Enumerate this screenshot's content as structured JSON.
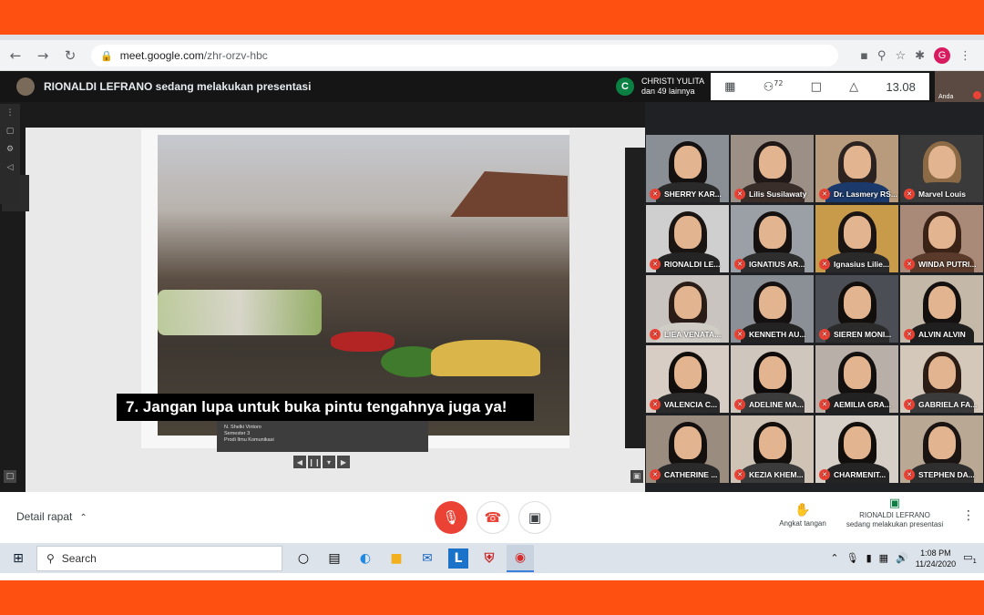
{
  "browser": {
    "url_host": "meet.google.com",
    "url_path": "/zhr-orzv-hbc",
    "profile_initial": "G"
  },
  "meet": {
    "presenting_banner": "RIONALDI LEFRANO sedang melakukan presentasi",
    "chat_chip": {
      "initial": "C",
      "name": "CHRISTI YULITA",
      "more": "dan 49 lainnya"
    },
    "participant_count": "72",
    "time": "13.08",
    "self_label": "Anda",
    "slide": {
      "caption": "7. Jangan lupa untuk buka pintu tengahnya juga ya!",
      "nameplate_line1": "N. Shelki Vintoro",
      "nameplate_line2": "Semester 3",
      "nameplate_line3": "Prodi Ilmu Komunikasi"
    },
    "participants": [
      {
        "name": "SHERRY KAR...",
        "bg": "#8a8f96",
        "hair": "#151110",
        "body": "#2a2a2a"
      },
      {
        "name": "Lilis Susilawaty",
        "bg": "#9c8f86",
        "hair": "#1f1816",
        "body": "#3a2e2a"
      },
      {
        "name": "Dr. Lasmery RS...",
        "bg": "#b79b7c",
        "hair": "#2c2220",
        "body": "#1b3a6b"
      },
      {
        "name": "Marvel Louis",
        "bg": "#3a3a3a",
        "hair": "#8c6a45",
        "body": "#3a3a3a"
      },
      {
        "name": "RIONALDI LE...",
        "bg": "#cfcfcf",
        "hair": "#1a1412",
        "body": "#242424"
      },
      {
        "name": "IGNATIUS AR...",
        "bg": "#9aa0a6",
        "hair": "#151110",
        "body": "#2e2e2e"
      },
      {
        "name": "Ignasius Lilie...",
        "bg": "#c79b4a",
        "hair": "#1a1412",
        "body": "#2a2a2a"
      },
      {
        "name": "WINDA PUTRI...",
        "bg": "#a98a78",
        "hair": "#3a2216",
        "body": "#5a3a2a"
      },
      {
        "name": "LIEA VENATA...",
        "bg": "#c9c4bf",
        "hair": "#2a1d18",
        "body": "#d0ccc6"
      },
      {
        "name": "KENNETH AU...",
        "bg": "#8a9096",
        "hair": "#151110",
        "body": "#232323"
      },
      {
        "name": "SIEREN MONI...",
        "bg": "#4b4f55",
        "hair": "#120e0c",
        "body": "#2b2b2b"
      },
      {
        "name": "ALVIN ALVIN",
        "bg": "#c4b8a8",
        "hair": "#141010",
        "body": "#1f1f1f"
      },
      {
        "name": "VALENCIA C...",
        "bg": "#d8cdc4",
        "hair": "#120e0c",
        "body": "#2a2a2a"
      },
      {
        "name": "ADELINE MA...",
        "bg": "#cfc6bd",
        "hair": "#0f0b0a",
        "body": "#3b3b3b"
      },
      {
        "name": "AEMILIA GRA...",
        "bg": "#b8b0a8",
        "hair": "#141010",
        "body": "#222222"
      },
      {
        "name": "GABRIELA FA...",
        "bg": "#d4c8bb",
        "hair": "#2b1d16",
        "body": "#3b3b3b"
      },
      {
        "name": "CATHERINE ...",
        "bg": "#9a8d80",
        "hair": "#141010",
        "body": "#2a2a2a"
      },
      {
        "name": "KEZIA KHEM...",
        "bg": "#cfc3b6",
        "hair": "#120e0c",
        "body": "#3b3b3b"
      },
      {
        "name": "CHARMENIT...",
        "bg": "#d6cfc8",
        "hair": "#120e0c",
        "body": "#242424"
      },
      {
        "name": "STEPHEN DA...",
        "bg": "#b8a894",
        "hair": "#1a1412",
        "body": "#2f2f2f"
      }
    ]
  },
  "controls": {
    "details_label": "Detail rapat",
    "raise_hand_label": "Angkat tangan",
    "presenting_name": "RIONALDI LEFRANO",
    "presenting_sub": "sedang melakukan presentasi"
  },
  "taskbar": {
    "search_label": "Search",
    "time": "1:08 PM",
    "date": "11/24/2020",
    "notification_count": "1"
  },
  "colors": {
    "frame": "#fe5111",
    "mic_off": "#ea4335",
    "meet_bg": "#202124"
  }
}
